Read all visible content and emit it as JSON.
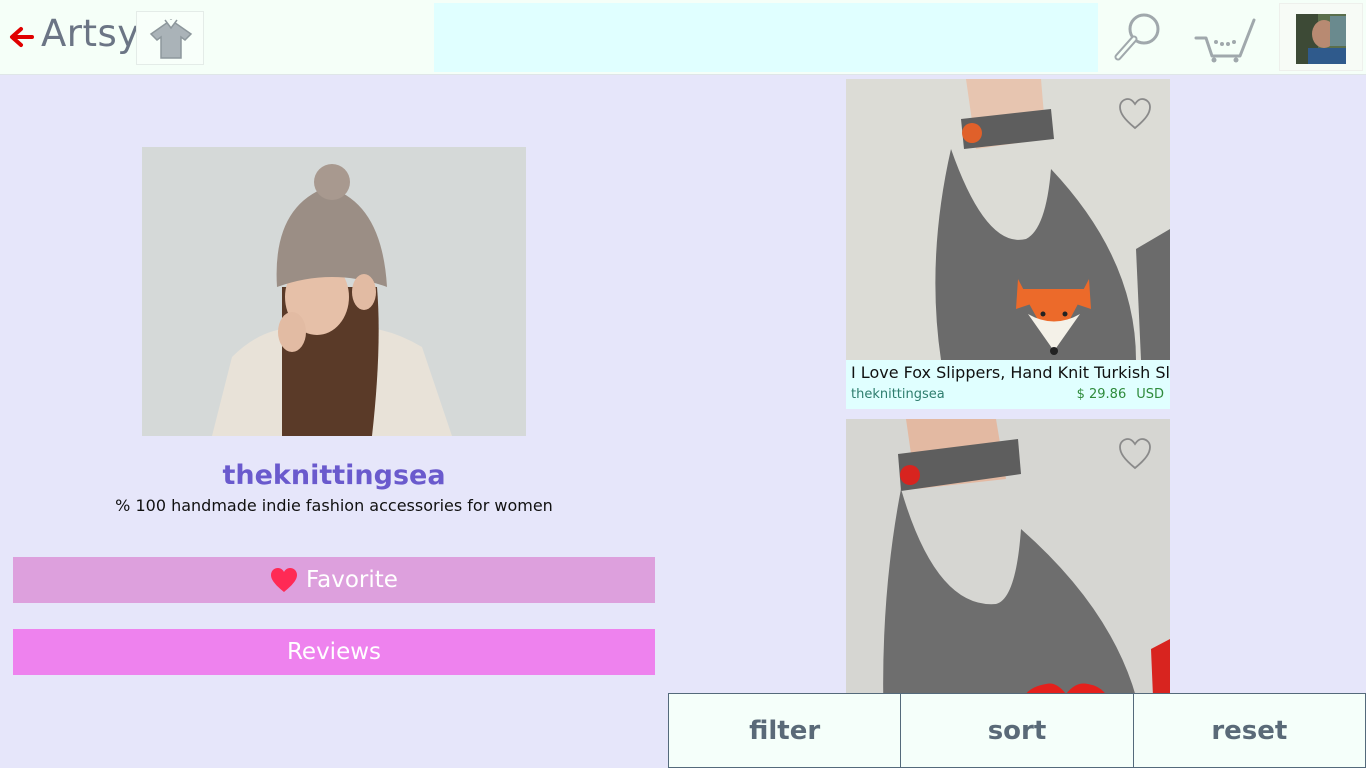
{
  "header": {
    "brand": "Artsy",
    "search_placeholder": "",
    "icons": [
      "back-arrow-icon",
      "home-shirt-icon",
      "search-icon",
      "cart-icon",
      "user-avatar"
    ]
  },
  "shop": {
    "name": "theknittingsea",
    "tagline": "% 100 handmade indie fashion accessories for women",
    "favorite_label": "Favorite",
    "reviews_label": "Reviews"
  },
  "items": [
    {
      "title": "I Love Fox Slippers, Hand Knit Turkish Sli",
      "seller": "theknittingsea",
      "price": "$ 29.86",
      "currency": "USD"
    },
    {
      "title": "",
      "seller": "",
      "price": "",
      "currency": ""
    }
  ],
  "bottom_bar": {
    "filter_label": "filter",
    "sort_label": "sort",
    "reset_label": "reset"
  },
  "colors": {
    "background": "#e6e6fa",
    "header": "#f5fff8",
    "search": "#e0ffff",
    "shop_name": "#6a5acd",
    "favorite_button": "#dda0dd",
    "reviews_button": "#ee82ee",
    "price": "#2e8b3b",
    "back_arrow": "#e00000"
  }
}
